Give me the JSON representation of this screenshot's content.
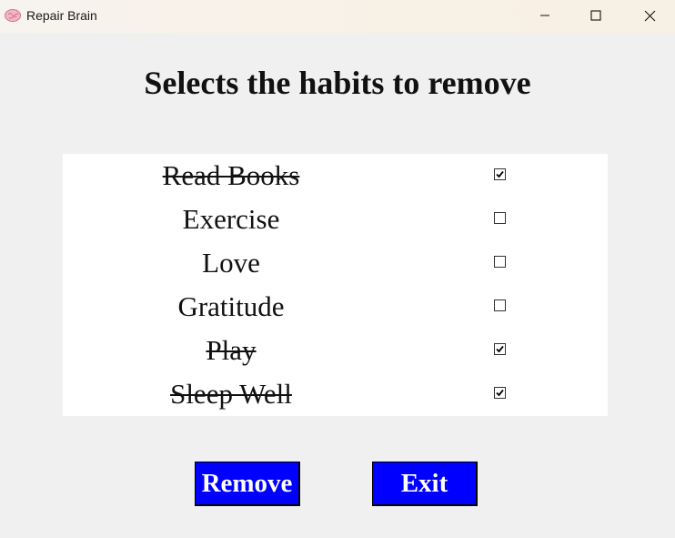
{
  "window": {
    "title": "Repair Brain",
    "app_icon": "brain-icon",
    "controls": [
      "minimize-icon",
      "maximize-icon",
      "close-icon"
    ]
  },
  "main": {
    "heading": "Selects the habits to remove",
    "habits": [
      {
        "label": "Read Books",
        "checked": true
      },
      {
        "label": "Exercise",
        "checked": false
      },
      {
        "label": "Love",
        "checked": false
      },
      {
        "label": "Gratitude",
        "checked": false
      },
      {
        "label": "Play",
        "checked": true
      },
      {
        "label": "Sleep Well",
        "checked": true
      }
    ]
  },
  "buttons": {
    "remove_label": "Remove",
    "exit_label": "Exit",
    "color": "#0000ff",
    "text_color": "#ffffff"
  }
}
